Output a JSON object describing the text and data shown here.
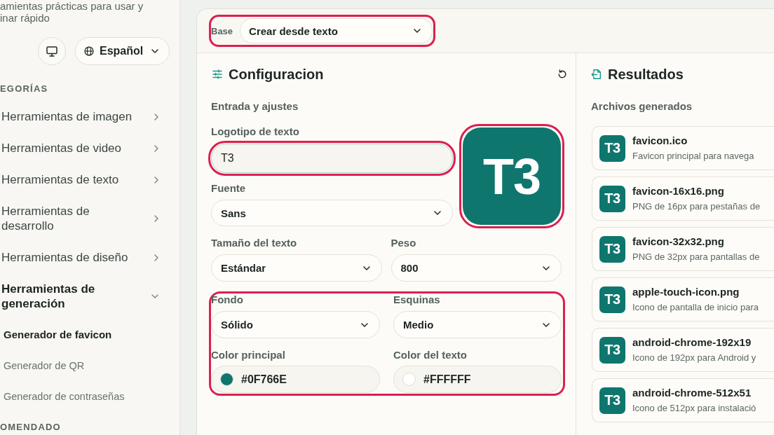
{
  "sidebar": {
    "description_lines": [
      "amientas prácticas para usar y",
      "inar rápido"
    ],
    "buttons": [
      {
        "kind": "display"
      },
      {
        "kind": "language",
        "label": "Español"
      }
    ],
    "section_title": "EGORÍAS",
    "categories": [
      {
        "label": "Herramientas de imagen",
        "expanded": false
      },
      {
        "label": "Herramientas de video",
        "expanded": false
      },
      {
        "label": "Herramientas de texto",
        "expanded": false
      },
      {
        "label": "Herramientas de desarrollo",
        "expanded": false
      },
      {
        "label": "Herramientas de diseño",
        "expanded": false
      },
      {
        "label": "Herramientas de generación",
        "expanded": true,
        "children": [
          {
            "label": "Generador de favicon",
            "selected": true
          },
          {
            "label": "Generador de QR",
            "selected": false
          },
          {
            "label": "Generador de contraseñas",
            "selected": false
          }
        ]
      }
    ],
    "next_section_title": "OMENDADO"
  },
  "panel": {
    "base": {
      "label": "Base",
      "value": "Crear desde texto",
      "highlighted": true
    },
    "config": {
      "title": "Configuracion",
      "subtitle": "Entrada y ajustes",
      "logo_text": {
        "label": "Logotipo de texto",
        "value": "T3",
        "highlighted": true
      },
      "preview": {
        "text": "T3",
        "highlighted": true
      },
      "font": {
        "label": "Fuente",
        "value": "Sans"
      },
      "size_weight": [
        {
          "label": "Tamaño del texto",
          "value": "Estándar"
        },
        {
          "label": "Peso",
          "value": "800"
        }
      ],
      "style_group": {
        "highlighted": true,
        "selects": [
          {
            "label": "Fondo",
            "value": "Sólido"
          },
          {
            "label": "Esquinas",
            "value": "Medio"
          }
        ],
        "colors": [
          {
            "label": "Color principal",
            "value": "#0F766E",
            "color": "#0f766e"
          },
          {
            "label": "Color del texto",
            "value": "#FFFFFF",
            "color": "#ffffff"
          }
        ]
      }
    },
    "results": {
      "title": "Resultados",
      "subtitle": "Archivos generados",
      "files": [
        {
          "badge": "T3",
          "name": "favicon.ico",
          "description": "Favicon principal para navega"
        },
        {
          "badge": "T3",
          "name": "favicon-16x16.png",
          "description": "PNG de 16px para pestañas de"
        },
        {
          "badge": "T3",
          "name": "favicon-32x32.png",
          "description": "PNG de 32px para pantallas de"
        },
        {
          "badge": "T3",
          "name": "apple-touch-icon.png",
          "description": "Icono de pantalla de inicio para"
        },
        {
          "badge": "T3",
          "name": "android-chrome-192x19",
          "description": "Icono de 192px para Android y"
        },
        {
          "badge": "T3",
          "name": "android-chrome-512x51",
          "description": "Icono de 512px para instalació"
        }
      ]
    }
  }
}
